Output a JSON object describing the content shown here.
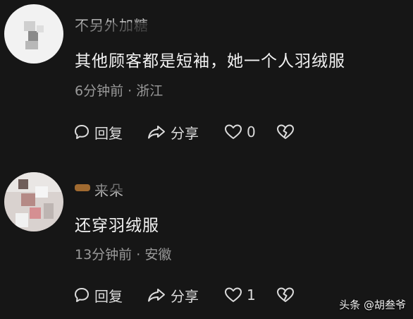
{
  "comments": [
    {
      "username": "不另外加糖",
      "text": "其他顾客都是短袖，她一个人羽绒服",
      "time": "6分钟前",
      "location": "浙江",
      "reply_label": "回复",
      "share_label": "分享",
      "like_count": "0"
    },
    {
      "username": "来朵",
      "text": "还穿羽绒服",
      "time": "13分钟前",
      "location": "安徽",
      "reply_label": "回复",
      "share_label": "分享",
      "like_count": "1"
    }
  ],
  "separator": "·",
  "watermark": "头条 @胡叁爷",
  "colors": {
    "background": "#161616",
    "text_primary": "#f2f2f2",
    "text_secondary": "#9a9a9a"
  },
  "icons": [
    "reply-icon",
    "share-icon",
    "heart-icon",
    "broken-heart-icon"
  ]
}
